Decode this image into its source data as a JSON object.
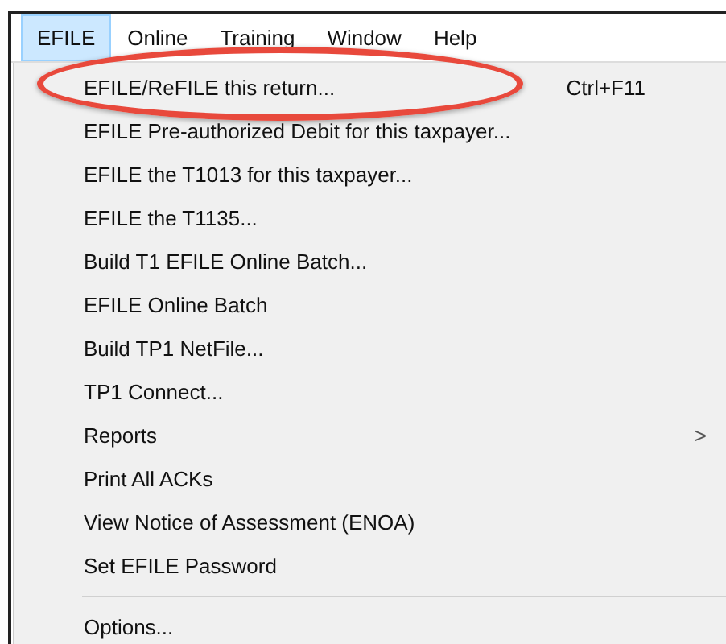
{
  "menu_bar": [
    {
      "label": "EFILE",
      "selected": true
    },
    {
      "label": "Online",
      "selected": false
    },
    {
      "label": "Training",
      "selected": false
    },
    {
      "label": "Window",
      "selected": false
    },
    {
      "label": "Help",
      "selected": false
    }
  ],
  "menu": [
    {
      "kind": "item",
      "label": "EFILE/ReFILE this return...",
      "shortcut": "Ctrl+F11",
      "circled": true
    },
    {
      "kind": "item",
      "label": "EFILE Pre-authorized Debit for this taxpayer...",
      "circled": false
    },
    {
      "kind": "item",
      "label": "EFILE the T1013 for this taxpayer...",
      "circled": false
    },
    {
      "kind": "item",
      "label": "EFILE the T1135...",
      "circled": false
    },
    {
      "kind": "item",
      "label": "Build T1 EFILE Online Batch...",
      "circled": false
    },
    {
      "kind": "item",
      "label": "EFILE Online Batch",
      "circled": false
    },
    {
      "kind": "item",
      "label": "Build TP1 NetFile...",
      "circled": false
    },
    {
      "kind": "item",
      "label": "TP1 Connect...",
      "circled": false
    },
    {
      "kind": "submenu",
      "label": "Reports",
      "arrow": ">",
      "circled": false
    },
    {
      "kind": "item",
      "label": "Print All ACKs",
      "circled": false
    },
    {
      "kind": "item",
      "label": "View Notice of Assessment (ENOA)",
      "circled": false
    },
    {
      "kind": "item",
      "label": "Set EFILE Password",
      "circled": false
    },
    {
      "kind": "separator"
    },
    {
      "kind": "item",
      "label": "Options...",
      "circled": false
    }
  ]
}
